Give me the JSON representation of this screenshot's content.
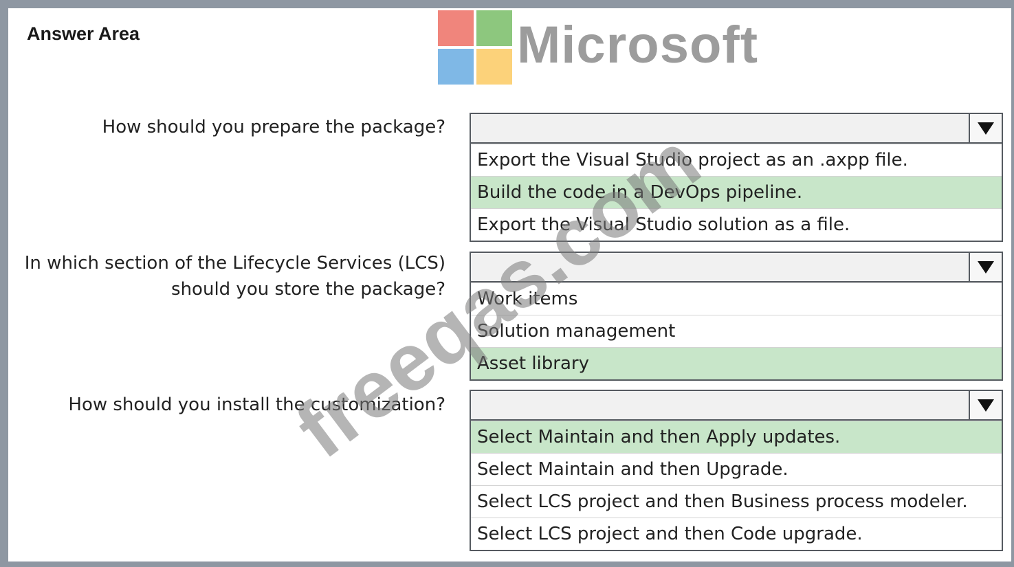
{
  "header": {
    "answer_area": "Answer Area",
    "brand": "Microsoft"
  },
  "logo_colors": {
    "top_left": "#f0857c",
    "top_right": "#8dc77e",
    "bottom_left": "#7fb8e6",
    "bottom_right": "#fcd27a"
  },
  "questions": [
    {
      "label_lines": [
        "How should you prepare the package?"
      ],
      "options": [
        "Export the Visual Studio project as an .axpp file.",
        "Build the code in a DevOps pipeline.",
        "Export the Visual Studio solution as a file."
      ],
      "selected_index": 1
    },
    {
      "label_lines": [
        "In which section of the Lifecycle Services (LCS)",
        "should you store the package?"
      ],
      "options": [
        "Work items",
        "Solution management",
        "Asset library"
      ],
      "selected_index": 2
    },
    {
      "label_lines": [
        "How should you install the customization?"
      ],
      "options": [
        "Select Maintain and then Apply updates.",
        "Select Maintain and then Upgrade.",
        "Select LCS project and then Business process modeler.",
        "Select LCS project and then Code upgrade."
      ],
      "selected_index": 0
    }
  ],
  "watermark": "freeqas.com",
  "selected_color": "#c8e6c9",
  "dropdown_icon": "triangle-down-icon"
}
